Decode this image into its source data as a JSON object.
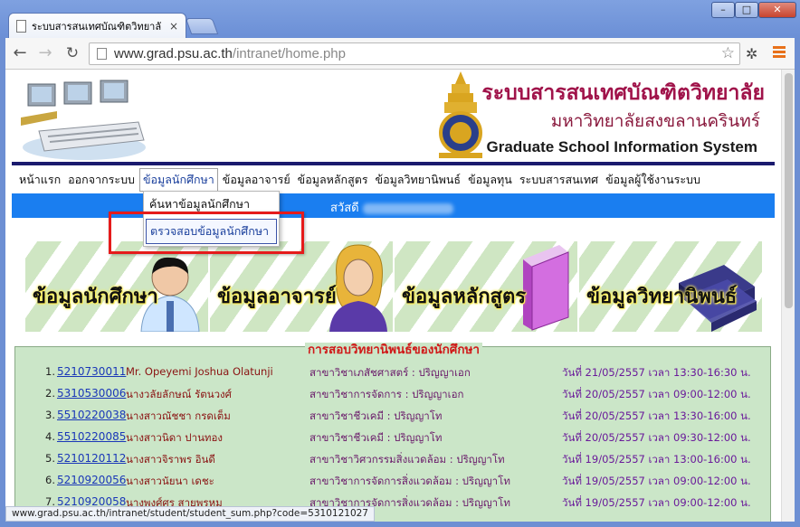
{
  "browser": {
    "tab_title": "ระบบสารสนเทศบัณฑิตวิทยาลั",
    "tab_close": "×",
    "url_host": "www.grad.psu.ac.th",
    "url_path": "/intranet/home.php",
    "win_min": "–",
    "win_max": "□",
    "win_close": "✕",
    "back_icon": "←",
    "forward_icon": "→",
    "reload_icon": "↻",
    "star_icon": "☆"
  },
  "banner": {
    "title_th": "ระบบสารสนเทศบัณฑิตวิทยาลัย",
    "subtitle_th": "มหาวิทยาลัยสงขลานครินทร์",
    "title_en": "Graduate School Information System"
  },
  "nav": {
    "items": [
      "หน้าแรก",
      "ออกจากระบบ",
      "ข้อมูลนักศึกษา",
      "ข้อมูลอาจารย์",
      "ข้อมูลหลักสูตร",
      "ข้อมูลวิทยานิพนธ์",
      "ข้อมูลทุน",
      "ระบบสารสนเทศ",
      "ข้อมูลผู้ใช้งานระบบ"
    ],
    "active_index": 2
  },
  "dropdown": {
    "items": [
      "ค้นหาข้อมูลนักศึกษา",
      "ตรวจสอบข้อมูลนักศึกษา"
    ],
    "highlighted_index": 1
  },
  "welcome": {
    "prefix": "สวัสดี"
  },
  "cards": [
    "ข้อมูลนักศึกษา",
    "ข้อมูลอาจารย์",
    "ข้อมูลหลักสูตร",
    "ข้อมูลวิทยานิพนธ์"
  ],
  "exam": {
    "heading": "การสอบวิทยานิพนธ์ของนักศึกษา",
    "rows": [
      {
        "num": "1.",
        "id": "5210730011",
        "name": "Mr. Opeyemi Joshua Olatunji",
        "program": "สาขาวิชาเภสัชศาสตร์ : ปริญญาเอก",
        "date": "วันที่ 21/05/2557 เวลา 13:30-16:30 น."
      },
      {
        "num": "2.",
        "id": "5310530006",
        "name": "นางวลัยลักษณ์ รัตนวงศ์",
        "program": "สาขาวิชาการจัดการ : ปริญญาเอก",
        "date": "วันที่ 20/05/2557 เวลา 09:00-12:00 น."
      },
      {
        "num": "3.",
        "id": "5510220038",
        "name": "นางสาวณัชชา กรดเต็ม",
        "program": "สาขาวิชาชีวเคมี : ปริญญาโท",
        "date": "วันที่ 20/05/2557 เวลา 13:30-16:00 น."
      },
      {
        "num": "4.",
        "id": "5510220085",
        "name": "นางสาวนิดา ปานทอง",
        "program": "สาขาวิชาชีวเคมี : ปริญญาโท",
        "date": "วันที่ 20/05/2557 เวลา 09:30-12:00 น."
      },
      {
        "num": "5.",
        "id": "5210120112",
        "name": "นางสาวจิราพร อินดี",
        "program": "สาขาวิชาวิศวกรรมสิ่งแวดล้อม : ปริญญาโท",
        "date": "วันที่ 19/05/2557 เวลา 13:00-16:00 น."
      },
      {
        "num": "6.",
        "id": "5210920056",
        "name": "นางสาวนัยนา เดชะ",
        "program": "สาขาวิชาการจัดการสิ่งแวดล้อม : ปริญญาโท",
        "date": "วันที่ 19/05/2557 เวลา 09:00-12:00 น."
      },
      {
        "num": "7.",
        "id": "5210920058",
        "name": "นางพงศ์ศร สายพรหม",
        "program": "สาขาวิชาการจัดการสิ่งแวดล้อม : ปริญญาโท",
        "date": "วันที่ 19/05/2557 เวลา 09:00-12:00 น."
      }
    ]
  },
  "status_url": "www.grad.psu.ac.th/intranet/student/student_sum.php?code=5310121027",
  "colors": {
    "accent_blue": "#1a7ef0",
    "heading_red": "#d01818",
    "highlight_box": "#e51b1b",
    "exam_bg": "#cbe6c8"
  }
}
